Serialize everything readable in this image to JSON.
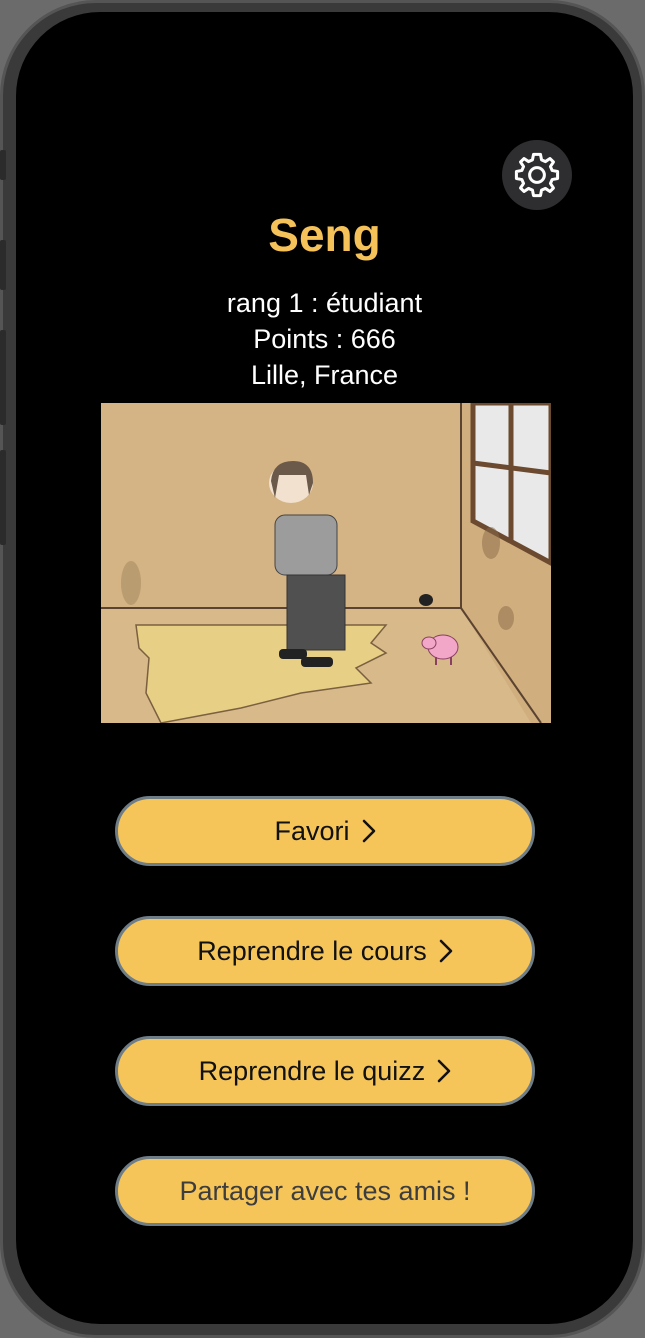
{
  "profile": {
    "name": "Seng",
    "rank_line": "rang  1 : étudiant",
    "points_line": "Points : 666",
    "location": "Lille, France"
  },
  "settings": {
    "icon": "gear-icon"
  },
  "illustration": {
    "description_icon": "profile-illustration"
  },
  "menu": {
    "favorites_label": "Favori",
    "resume_course_label": "Reprendre le cours",
    "resume_quiz_label": "Reprendre le quizz",
    "share_label": "Partager avec tes amis !"
  },
  "colors": {
    "accent": "#f5c25a",
    "button_fill": "#f6c55a",
    "button_border": "#6f7d86",
    "background": "#000000"
  }
}
